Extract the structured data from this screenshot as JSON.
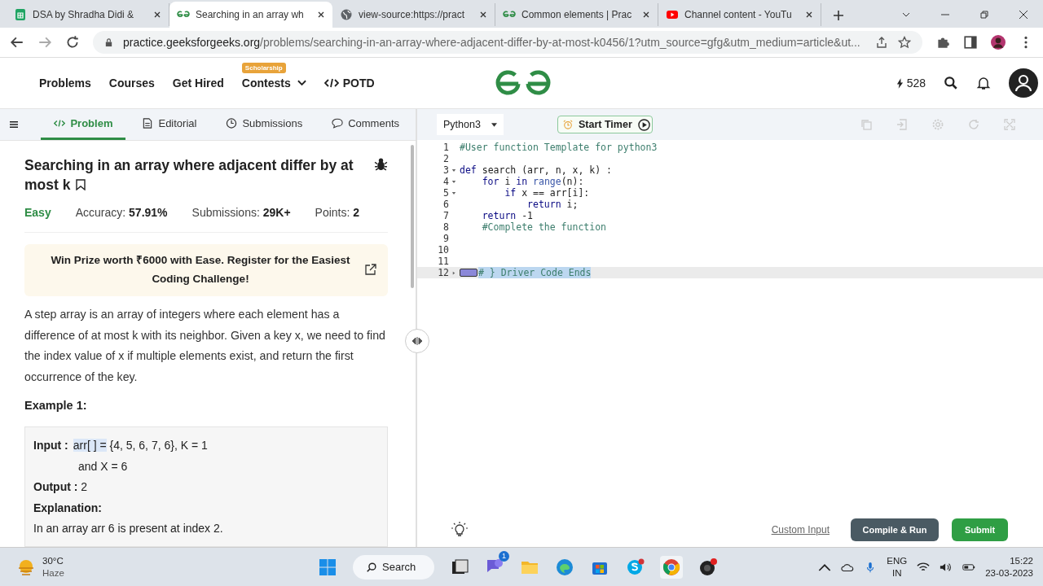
{
  "browser": {
    "tabs": [
      {
        "title": "DSA by Shradha Didi &",
        "selected": false
      },
      {
        "title": "Searching in an array wh",
        "selected": true
      },
      {
        "title": "view-source:https://pract",
        "selected": false
      },
      {
        "title": "Common elements | Prac",
        "selected": false
      },
      {
        "title": "Channel content - YouTu",
        "selected": false
      }
    ],
    "url_host": "practice.geeksforgeeks.org",
    "url_path": "/problems/searching-in-an-array-where-adjacent-differ-by-at-most-k0456/1?utm_source=gfg&utm_medium=article&ut..."
  },
  "site_header": {
    "nav": [
      {
        "label": "Problems",
        "kind": "plain"
      },
      {
        "label": "Courses",
        "kind": "plain"
      },
      {
        "label": "Get Hired",
        "kind": "plain"
      },
      {
        "label": "Contests",
        "kind": "dropdown",
        "badge": "Scholarship"
      },
      {
        "label": "POTD",
        "kind": "code"
      }
    ],
    "streak": "528"
  },
  "problem_tabs": [
    {
      "label": "Problem",
      "selected": true
    },
    {
      "label": "Editorial",
      "selected": false
    },
    {
      "label": "Submissions",
      "selected": false
    },
    {
      "label": "Comments",
      "selected": false
    }
  ],
  "problem": {
    "title": "Searching in an array where adjacent differ by at most k",
    "difficulty": "Easy",
    "stats": [
      {
        "label": "Accuracy:",
        "value": "57.91%"
      },
      {
        "label": "Submissions:",
        "value": "29K+"
      },
      {
        "label": "Points:",
        "value": "2"
      }
    ],
    "banner": "Win Prize worth ₹6000 with Ease. Register for the Easiest Coding Challenge!",
    "description": "A step array is an array of integers where each element has a difference of at most k with its neighbor. Given a key x, we need to find the index value of x if multiple elements exist, and return the first occurrence of the key.",
    "example_heading": "Example 1:",
    "example": [
      {
        "kind": "field",
        "label": "Input :",
        "selected_part": "arr[ ] =",
        "value": " {4, 5, 6, 7, 6}, K = 1"
      },
      {
        "kind": "continuation",
        "value": "and X = 6"
      },
      {
        "kind": "field",
        "label": "Output :",
        "value": " 2"
      },
      {
        "kind": "heading",
        "value": "Explanation:"
      },
      {
        "kind": "text",
        "value": "In an array arr 6 is present at index 2."
      }
    ]
  },
  "editor": {
    "language": "Python3",
    "timer": "Start Timer",
    "lines": [
      {
        "number": "1",
        "fold": false,
        "highlighted": false,
        "tokens": [
          {
            "kind": "comment",
            "text": "#User function Template for python3"
          }
        ]
      },
      {
        "number": "2",
        "fold": false,
        "highlighted": false
      },
      {
        "number": "3",
        "fold": true,
        "highlighted": false,
        "tokens": [
          {
            "kind": "keyword",
            "text": "def"
          },
          {
            "kind": "plain",
            "text": " search (arr, n, x, k) :"
          }
        ]
      },
      {
        "number": "4",
        "fold": true,
        "highlighted": false,
        "tokens": [
          {
            "kind": "keyword",
            "text": "    for"
          },
          {
            "kind": "plain",
            "text": " i "
          },
          {
            "kind": "keyword",
            "text": "in"
          },
          {
            "kind": "builtin",
            "text": " range"
          },
          {
            "kind": "plain",
            "text": "(n):"
          }
        ]
      },
      {
        "number": "5",
        "fold": true,
        "highlighted": false,
        "tokens": [
          {
            "kind": "keyword",
            "text": "        if"
          },
          {
            "kind": "plain",
            "text": " x == arr[i]:"
          }
        ]
      },
      {
        "number": "6",
        "fold": false,
        "highlighted": false,
        "tokens": [
          {
            "kind": "keyword",
            "text": "            return"
          },
          {
            "kind": "plain",
            "text": " i;"
          }
        ]
      },
      {
        "number": "7",
        "fold": false,
        "highlighted": false,
        "tokens": [
          {
            "kind": "keyword",
            "text": "    return"
          },
          {
            "kind": "plain",
            "text": " -1"
          }
        ]
      },
      {
        "number": "8",
        "fold": false,
        "highlighted": false,
        "tokens": [
          {
            "kind": "comment",
            "text": "    #Complete the function"
          }
        ]
      },
      {
        "number": "9",
        "fold": false,
        "highlighted": false
      },
      {
        "number": "10",
        "fold": false,
        "highlighted": false
      },
      {
        "number": "11",
        "fold": false,
        "highlighted": false
      },
      {
        "number": "12",
        "fold": false,
        "collapsed": true,
        "highlighted": true,
        "tokens": [
          {
            "kind": "comment",
            "text": "# } Driver Code Ends"
          }
        ]
      }
    ],
    "custom_input": "Custom Input",
    "compile": "Compile & Run",
    "submit": "Submit"
  },
  "taskbar": {
    "temperature": "30°C",
    "weather": "Haze",
    "search": "Search",
    "chat_badge": "1",
    "lang": "ENG",
    "region": "IN",
    "time": "15:22",
    "date": "23-03-2023"
  }
}
